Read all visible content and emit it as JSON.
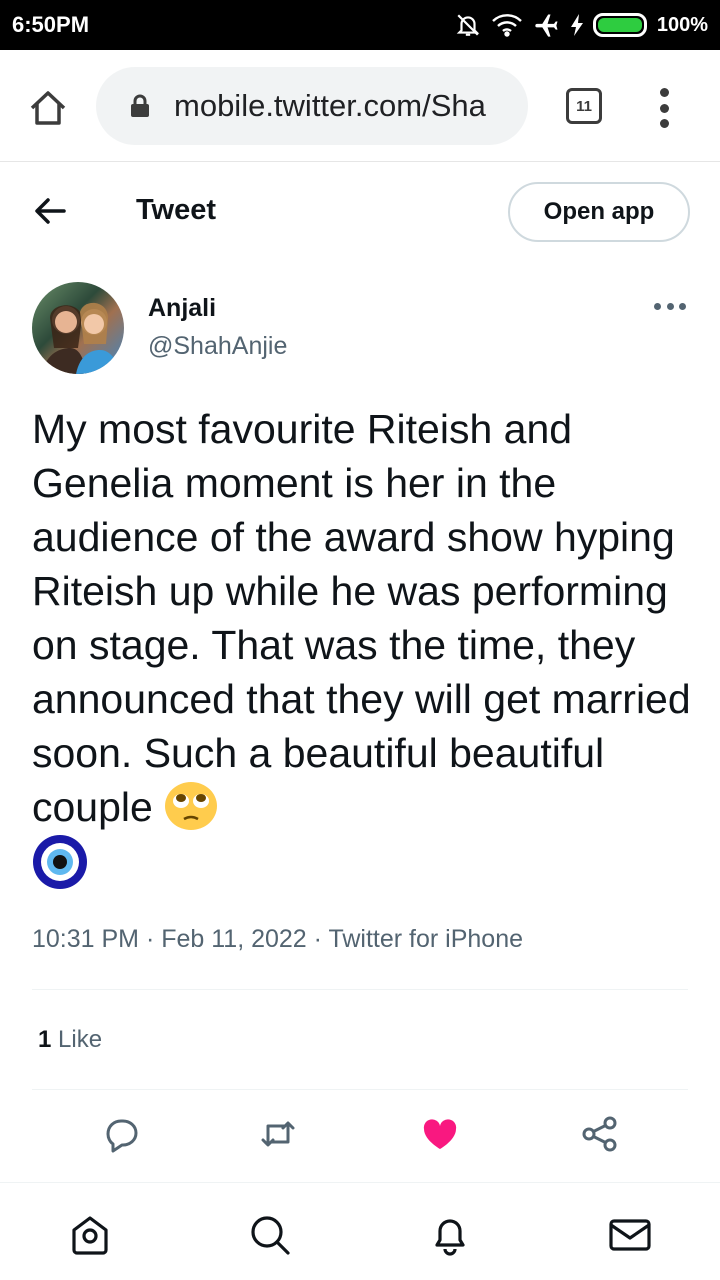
{
  "status_bar": {
    "time": "6:50PM",
    "battery": "100%",
    "battery_level": 1.0
  },
  "browser": {
    "url": "mobile.twitter.com/Sha",
    "tab_count": "11"
  },
  "header": {
    "title": "Tweet",
    "open_app_label": "Open app"
  },
  "tweet": {
    "author_name": "Anjali",
    "author_handle": "@ShahAnjie",
    "text": "My most favourite Riteish and Genelia moment is her in the audience of the award show hyping Riteish up while he was performing on stage. That was the time, they announced that they will get married soon. Such a beautiful beautiful couple",
    "meta": "10:31 PM · Feb 11, 2022 · Twitter for iPhone",
    "like_count": "1",
    "like_label": "Like"
  },
  "colors": {
    "like_active": "#f91880",
    "secondary_text": "#536471",
    "primary_text": "#0f1419"
  },
  "icons": {
    "home": "home-icon",
    "lock": "lock-icon",
    "back": "arrow-left-icon",
    "more": "more-horizontal-icon",
    "reply": "reply-icon",
    "retweet": "retweet-icon",
    "like": "heart-icon",
    "share": "share-icon",
    "nav_home": "home-icon",
    "nav_search": "search-icon",
    "nav_notifications": "bell-icon",
    "nav_messages": "mail-icon"
  }
}
